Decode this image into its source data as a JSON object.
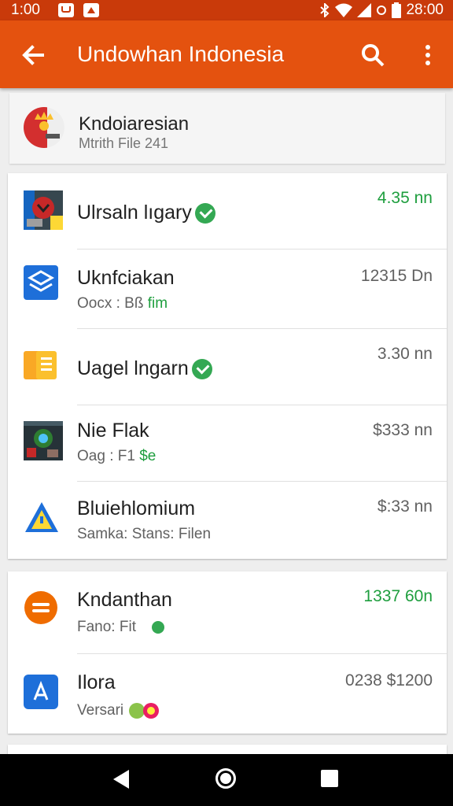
{
  "status_bar": {
    "time_left": "1:00",
    "time_right": "28:00"
  },
  "app_bar": {
    "title": "Undowhan Indonesia"
  },
  "header": {
    "title": "Kndoiaresian",
    "subtitle": "Mtrith File 241"
  },
  "group1": [
    {
      "name": "Ulrsaln lıgary",
      "sub_prefix": "",
      "sub_highlight": "",
      "time": "4.35 nn",
      "time_color": "green",
      "verified": true,
      "icon": "game-thumbnail-icon"
    },
    {
      "name": "Uknfciakan",
      "sub_prefix": "Oocx : Bß",
      "sub_highlight": "fim",
      "time": "12315 Dn",
      "time_color": "gray",
      "verified": false,
      "icon": "layers-app-icon"
    },
    {
      "name": "Uagel lngarn",
      "sub_prefix": "",
      "sub_highlight": "",
      "time": "3.30 nn",
      "time_color": "gray",
      "verified": true,
      "icon": "document-app-icon"
    },
    {
      "name": "Nie Flak",
      "sub_prefix": "Oag : F1",
      "sub_highlight": "$e",
      "time": "$333 nn",
      "time_color": "gray",
      "verified": false,
      "icon": "game-art-icon"
    },
    {
      "name": "Bluiehlomium",
      "sub_prefix": "Samka: Stans: Filen",
      "sub_highlight": "",
      "time": "$:33 nn",
      "time_color": "gray",
      "verified": false,
      "icon": "warning-triangle-app-icon"
    }
  ],
  "group2": [
    {
      "name": "Kndanthan",
      "sub_prefix": "Fano: Fit",
      "sub_highlight": "",
      "time": "1337 60n",
      "time_color": "green",
      "icon": "chat-bubble-app-icon"
    },
    {
      "name": "Ilora",
      "sub_prefix": "Versari",
      "sub_highlight": "",
      "time": "0238 $1200",
      "time_color": "mixed",
      "icon": "a-app-icon"
    }
  ],
  "colors": {
    "app_bar": "#e4520f",
    "status_bar": "#c93a0a",
    "accent_green": "#1e9e3e"
  }
}
